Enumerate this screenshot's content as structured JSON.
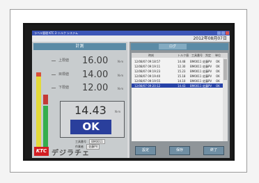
{
  "window": {
    "title": "ラベル管理 KTC 2-トルク システム"
  },
  "header": {
    "date": "2012年08月07日"
  },
  "left_panel": {
    "title": "計測",
    "thresholds": [
      {
        "label": "上限値",
        "value": "16.00",
        "unit": "N·m"
      },
      {
        "label": "目標値",
        "value": "14.00",
        "unit": "N·m"
      },
      {
        "label": "下限値",
        "value": "12.00",
        "unit": "N·m"
      }
    ],
    "measurement": {
      "value": "14.43",
      "unit": "N·m",
      "result": "OK"
    },
    "info": [
      {
        "label": "工具番号",
        "value": "BM0011"
      },
      {
        "label": "作業者",
        "value": "佐藤PV"
      }
    ],
    "brand": {
      "logo": "KTC",
      "text": "デジラチェ"
    }
  },
  "right_panel": {
    "tab_label": "ログ",
    "columns": [
      "時刻",
      "トルク値",
      "工具番号",
      "判定",
      "単位"
    ],
    "rows": [
      [
        "12/08/07 09:18:57",
        "14.48",
        "BM0011",
        "佐藤PV",
        "OK"
      ],
      [
        "12/08/07 09:19:11",
        "12.30",
        "BM0011",
        "佐藤PV",
        "OK"
      ],
      [
        "12/08/07 09:19:23",
        "15.23",
        "BM0011",
        "佐藤PV",
        "OK"
      ],
      [
        "12/08/07 09:19:40",
        "15.18",
        "BM0011",
        "佐藤PV",
        "OK"
      ],
      [
        "12/08/07 09:19:55",
        "14.10",
        "BM0011",
        "佐藤PV",
        "OK"
      ],
      [
        "12/08/07 09:20:12",
        "14.43",
        "BM0011",
        "佐藤PV",
        "OK"
      ]
    ],
    "selected_row": 5,
    "buttons": [
      "設定",
      "保存",
      "終了"
    ]
  },
  "colors": {
    "title_bar": "#3d56b8",
    "panel_header": "#5b8ba6",
    "ok_badge": "#2a3f9c",
    "selected_row": "#2743a8",
    "brand_red": "#d21e23"
  }
}
